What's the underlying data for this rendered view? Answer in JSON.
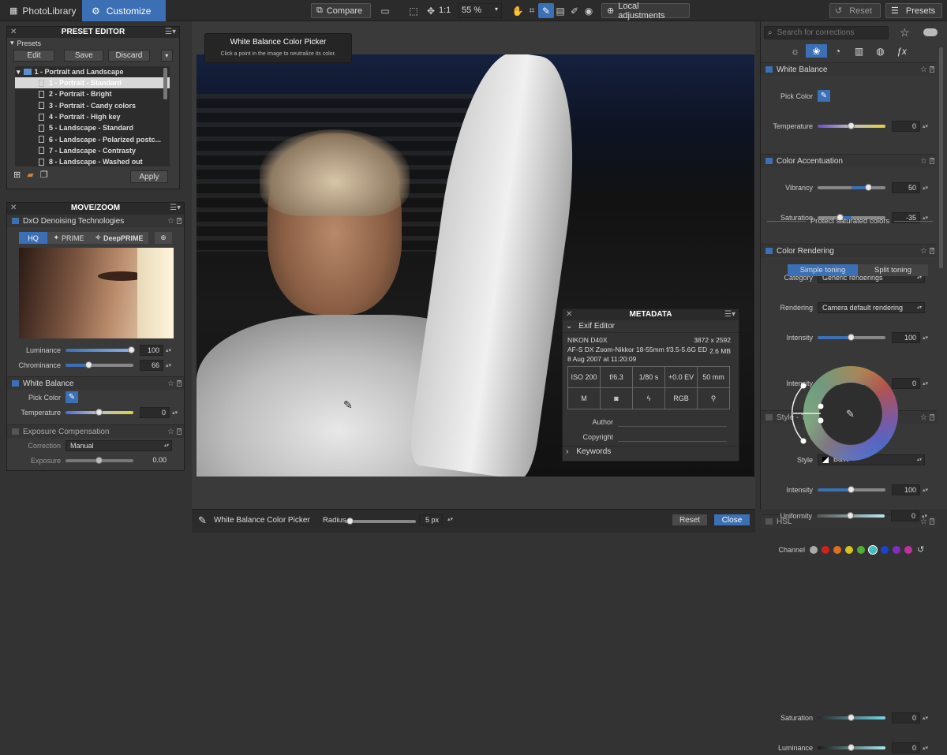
{
  "topbar": {
    "tab_library": "PhotoLibrary",
    "tab_customize": "Customize",
    "compare": "Compare",
    "zoom_1to1": "1:1",
    "zoom_level": "55 %",
    "local_adjustments": "Local adjustments",
    "reset": "Reset",
    "presets": "Presets"
  },
  "tooltip": {
    "title": "White Balance Color Picker",
    "text": "Click a point in the image to neutralize its color."
  },
  "preset_editor": {
    "title": "PRESET EDITOR",
    "group_label": "Presets",
    "edit": "Edit",
    "save": "Save",
    "discard": "Discard",
    "folder": "1 - Portrait and Landscape",
    "items": [
      "1 - Portrait - Standard",
      "2 - Portrait - Bright",
      "3 - Portrait - Candy colors",
      "4 - Portrait - High key",
      "5 - Landscape - Standard",
      "6 - Landscape - Polarized postc...",
      "7 - Landscape - Contrasty",
      "8 - Landscape - Washed out"
    ],
    "apply": "Apply"
  },
  "move_zoom": {
    "title": "MOVE/ZOOM",
    "denoise_title": "DxO Denoising Technologies",
    "hq": "HQ",
    "prime": "PRIME",
    "deepprime": "DeepPRIME",
    "luminance_label": "Luminance",
    "luminance_value": "100",
    "chrominance_label": "Chrominance",
    "chrominance_value": "66",
    "wb_title": "White Balance",
    "pick_color": "Pick Color",
    "temperature_label": "Temperature",
    "temperature_value": "0",
    "exposure_title": "Exposure Compensation",
    "correction_label": "Correction",
    "correction_value": "Manual",
    "exposure_label": "Exposure",
    "exposure_value": "0.00"
  },
  "metadata": {
    "title": "METADATA",
    "exif_editor": "Exif Editor",
    "camera": "NIKON D40X",
    "dimensions": "3872 x 2592",
    "lens": "AF-S DX Zoom-Nikkor 18-55mm f/3.5-5.6G ED",
    "filesize": "2.6 MB",
    "date": "8 Aug 2007 at 11:20:09",
    "iso": "ISO 200",
    "aperture": "f/6.3",
    "shutter": "1/80 s",
    "ev": "+0.0 EV",
    "focal": "50 mm",
    "mode": "M",
    "colorspace": "RGB",
    "author_label": "Author",
    "copyright_label": "Copyright",
    "keywords": "Keywords"
  },
  "right": {
    "search_placeholder": "Search for corrections",
    "wb_title": "White Balance",
    "pick_color": "Pick Color",
    "temperature_label": "Temperature",
    "temperature_value": "0",
    "ca_title": "Color Accentuation",
    "vibrancy_label": "Vibrancy",
    "vibrancy_value": "50",
    "saturation_label": "Saturation",
    "saturation_value": "-35",
    "cr_title": "Color Rendering",
    "category_label": "Category",
    "category_value": "Generic renderings",
    "rendering_label": "Rendering",
    "rendering_value": "Camera default rendering",
    "intensity_label": "Intensity",
    "intensity_value": "100",
    "protect_label": "Protect saturated colors",
    "protect_intensity_value": "0",
    "toning_title": "Style - Toning",
    "simple_toning": "Simple toning",
    "split_toning": "Split toning",
    "style_label": "Style",
    "style_value": "B&W",
    "toning_intensity_value": "100",
    "hsl_title": "HSL",
    "channel_label": "Channel",
    "hsl_saturation_label": "Saturation",
    "hsl_saturation_value": "0",
    "hsl_luminance_label": "Luminance",
    "hsl_luminance_value": "0",
    "uniformity_label": "Uniformity",
    "uniformity_value": "0",
    "channel_colors": [
      "#aaaaaa",
      "#d02020",
      "#e07020",
      "#d8c020",
      "#50b030",
      "#40c0c0",
      "#2040d0",
      "#8030c0",
      "#c030a0"
    ]
  },
  "bottombar": {
    "tool_label": "White Balance Color Picker",
    "radius_label": "Radius",
    "radius_value": "5 px",
    "reset": "Reset",
    "close": "Close"
  },
  "colors": {
    "accent": "#3c6fb4"
  }
}
